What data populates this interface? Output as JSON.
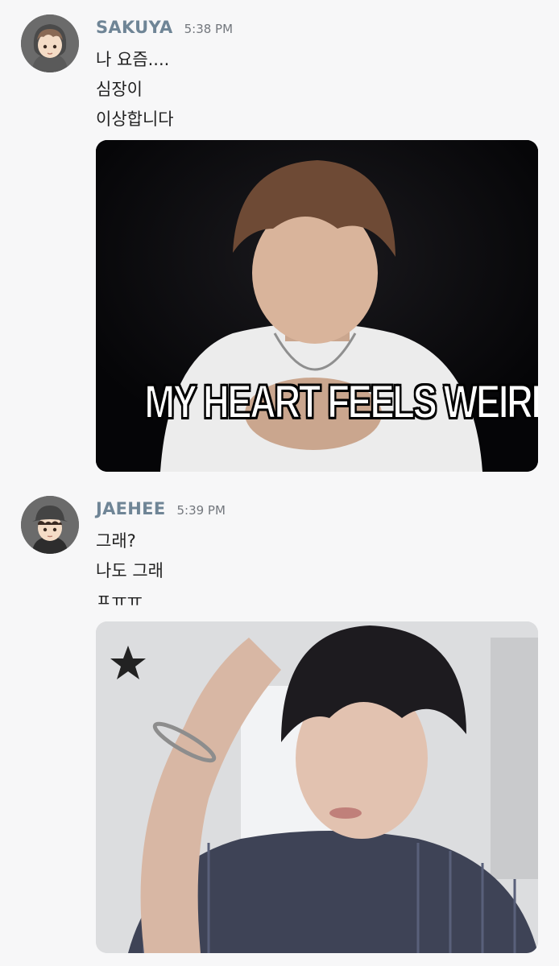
{
  "messages": [
    {
      "username": "SAKUYA",
      "timestamp": "5:38 PM",
      "lines": [
        "나 요즘....",
        "심장이",
        "이상합니다"
      ],
      "avatar_icon": "cartoon-boy-hoodie-avatar",
      "media": {
        "kind": "meme-image",
        "caption": "MY HEART FEELS WEIRD"
      }
    },
    {
      "username": "JAEHEE",
      "timestamp": "5:39 PM",
      "lines": [
        "그래?",
        "나도 그래",
        "ㅍㅠㅠ"
      ],
      "avatar_icon": "cartoon-boy-cap-avatar",
      "media": {
        "kind": "photo"
      }
    }
  ],
  "colors": {
    "background": "#f7f7f8",
    "username": "#6f8596",
    "timestamp": "#73777d",
    "message_text": "#222222",
    "caption_text": "#ffffff"
  }
}
